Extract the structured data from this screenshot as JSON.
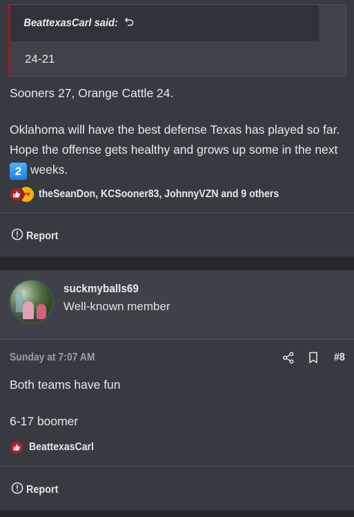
{
  "post1": {
    "quote": {
      "author_said": "BeattexasCarl said:",
      "text": "24-21"
    },
    "body_line1": "Sooners 27, Orange Cattle 24.",
    "body_para2_a": "Oklahoma will have the best defense Texas has played so far. Hope the offense gets healthy and grows up some in the next ",
    "badge": "2",
    "body_para2_b": " weeks.",
    "reactors": "theSeanDon, KCSooner83, JohnnyVZN and 9 others",
    "report_label": "Report"
  },
  "post2": {
    "username": "suckmyballs69",
    "user_title": "Well-known member",
    "timestamp": "Sunday at 7:07 AM",
    "post_number": "#8",
    "body_line1": "Both teams have fun",
    "body_line2": "6-17 boomer",
    "reactors": "BeattexasCarl",
    "report_label": "Report"
  },
  "icons": {
    "quote_return": "return-arrow-icon",
    "like": "thumbs-up-icon",
    "love": "heart-eyes-icon",
    "report": "alert-circle-icon",
    "share": "share-icon",
    "bookmark": "bookmark-icon"
  },
  "colors": {
    "background": "#25272c",
    "post_background": "#383a42",
    "quote_accent": "#9c1b1b",
    "like_red": "#b31f1f",
    "badge_blue": "#1a7fe0"
  }
}
